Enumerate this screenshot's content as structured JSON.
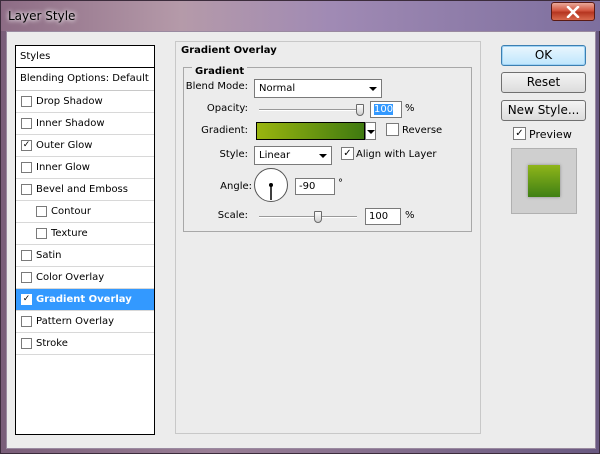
{
  "window": {
    "title": "Layer Style"
  },
  "left_panel": {
    "header": "Styles",
    "blending_options": "Blending Options: Default",
    "items": [
      {
        "label": "Drop Shadow",
        "checked": false,
        "sub": false,
        "selected": false
      },
      {
        "label": "Inner Shadow",
        "checked": false,
        "sub": false,
        "selected": false
      },
      {
        "label": "Outer Glow",
        "checked": true,
        "sub": false,
        "selected": false
      },
      {
        "label": "Inner Glow",
        "checked": false,
        "sub": false,
        "selected": false
      },
      {
        "label": "Bevel and Emboss",
        "checked": false,
        "sub": false,
        "selected": false
      },
      {
        "label": "Contour",
        "checked": false,
        "sub": true,
        "selected": false
      },
      {
        "label": "Texture",
        "checked": false,
        "sub": true,
        "selected": false
      },
      {
        "label": "Satin",
        "checked": false,
        "sub": false,
        "selected": false
      },
      {
        "label": "Color Overlay",
        "checked": false,
        "sub": false,
        "selected": false
      },
      {
        "label": "Gradient Overlay",
        "checked": true,
        "sub": false,
        "selected": true
      },
      {
        "label": "Pattern Overlay",
        "checked": false,
        "sub": false,
        "selected": false
      },
      {
        "label": "Stroke",
        "checked": false,
        "sub": false,
        "selected": false
      }
    ]
  },
  "main": {
    "section_title": "Gradient Overlay",
    "group_title": "Gradient",
    "blend_mode": {
      "label": "Blend Mode:",
      "value": "Normal"
    },
    "opacity": {
      "label": "Opacity:",
      "value": "100",
      "unit": "%",
      "level": 1.0
    },
    "gradient": {
      "label": "Gradient:",
      "color_start": "#9ab50f",
      "color_end": "#3f7a10"
    },
    "reverse": {
      "label": "Reverse",
      "checked": false
    },
    "style": {
      "label": "Style:",
      "value": "Linear"
    },
    "align_with_layer": {
      "label": "Align with Layer",
      "checked": true
    },
    "angle": {
      "label": "Angle:",
      "value": "-90",
      "unit": "°"
    },
    "scale": {
      "label": "Scale:",
      "value": "100",
      "unit": "%",
      "level": 0.6
    }
  },
  "buttons": {
    "ok": "OK",
    "reset": "Reset",
    "new_style": "New Style...",
    "preview": {
      "label": "Preview",
      "checked": true
    }
  },
  "colors": {
    "selection": "#3399ff",
    "preview_gradient_start": "#8fb51a",
    "preview_gradient_end": "#3f8014"
  }
}
